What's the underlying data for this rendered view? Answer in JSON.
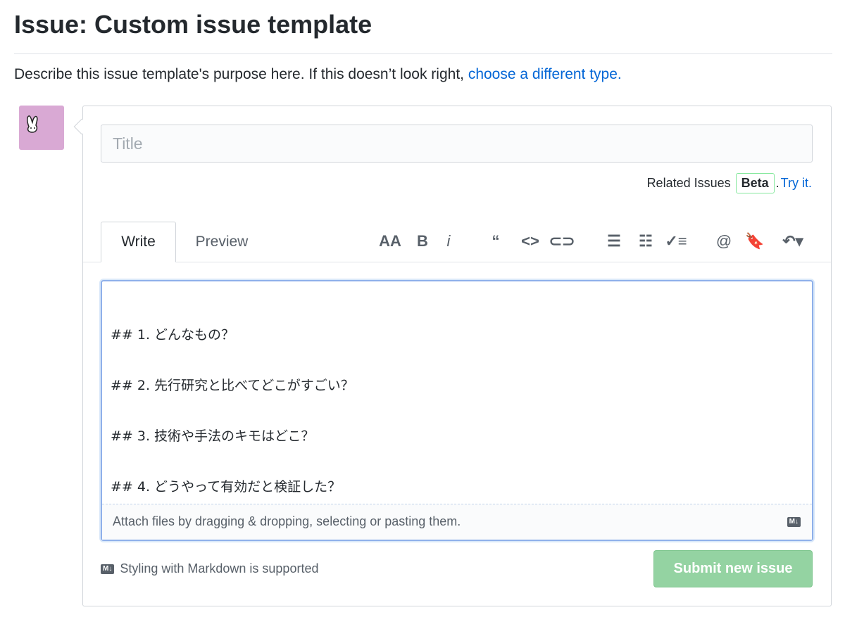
{
  "header": {
    "title": "Issue: Custom issue template",
    "description": "Describe this issue template's purpose here. If this doesn’t look right, ",
    "link": "choose a different type."
  },
  "form": {
    "title_placeholder": "Title",
    "related": {
      "label": "Related Issues",
      "badge": "Beta",
      "dot": ".",
      "link": "Try it."
    },
    "tabs": [
      {
        "label": "Write"
      },
      {
        "label": "Preview"
      }
    ],
    "toolbar": [
      {
        "icon": "text-size-icon",
        "glyph": "AA"
      },
      {
        "icon": "bold-icon",
        "glyph": "B"
      },
      {
        "icon": "italic-icon",
        "glyph": "i"
      },
      {
        "icon": "quote-icon",
        "glyph": "“"
      },
      {
        "icon": "code-icon",
        "glyph": "<>"
      },
      {
        "icon": "link-icon",
        "glyph": "⊂⊃"
      },
      {
        "icon": "bulleted-list-icon",
        "glyph": "☰"
      },
      {
        "icon": "numbered-list-icon",
        "glyph": "☷"
      },
      {
        "icon": "task-list-icon",
        "glyph": "✓≡"
      },
      {
        "icon": "mention-icon",
        "glyph": "@"
      },
      {
        "icon": "saved-reply-icon",
        "glyph": "🔖"
      },
      {
        "icon": "reply-icon",
        "glyph": "↶▾"
      }
    ],
    "body": "## 1. どんなもの？\n## 2. 先行研究と比べてどこがすごい？\n## 3. 技術や手法のキモはどこ？\n## 4. どうやって有効だと検証した？",
    "attach": "Attach files by dragging & dropping, selecting or pasting them.",
    "markdown_badge": "M↓",
    "markdown_hint": "Styling with Markdown is supported",
    "submit": "Submit new issue"
  },
  "colors": {
    "accent": "#0366d6",
    "avatar": "#d9a9d4",
    "submit": "#94d3a2"
  }
}
